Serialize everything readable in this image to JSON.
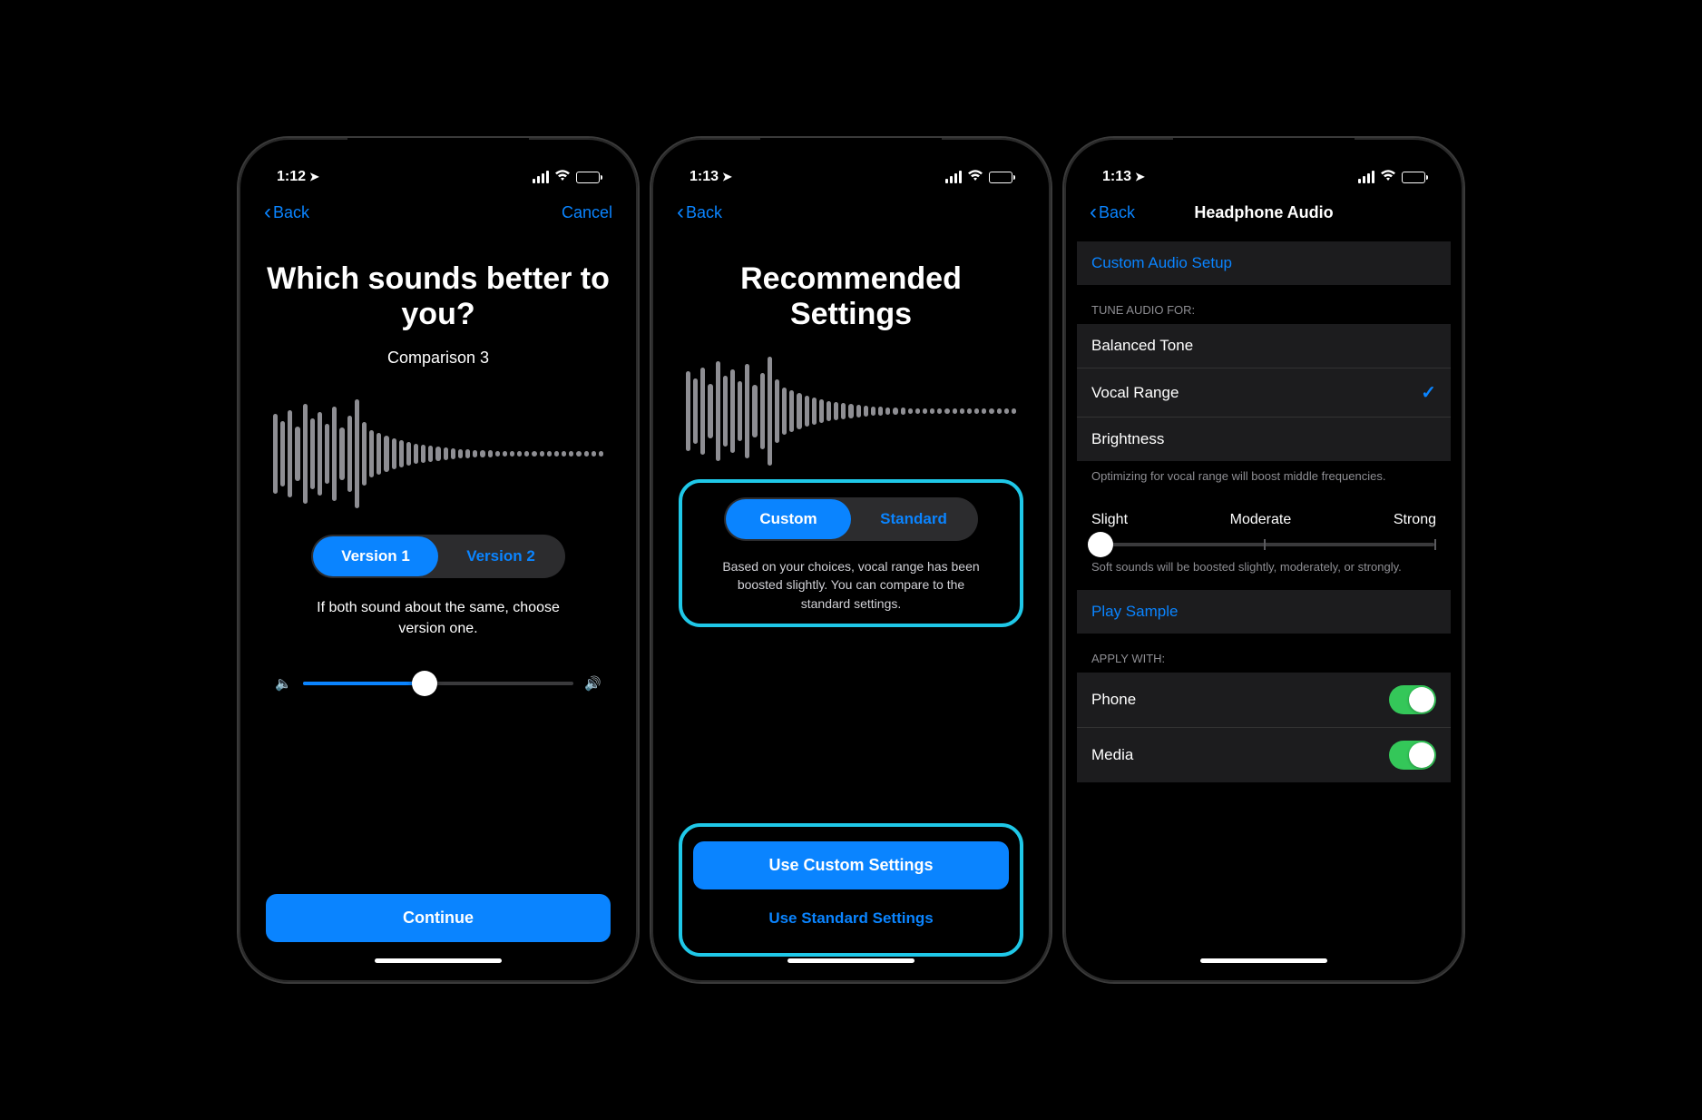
{
  "screen1": {
    "time": "1:12",
    "nav": {
      "back": "Back",
      "cancel": "Cancel"
    },
    "title": "Which sounds better to you?",
    "subtitle": "Comparison 3",
    "segments": {
      "a": "Version 1",
      "b": "Version 2"
    },
    "hint": "If both sound about the same, choose version one.",
    "volume_percent": 45,
    "continue": "Continue"
  },
  "screen2": {
    "time": "1:13",
    "nav": {
      "back": "Back"
    },
    "title": "Recommended Settings",
    "segments": {
      "a": "Custom",
      "b": "Standard"
    },
    "desc": "Based on your choices, vocal range has been boosted slightly. You can compare to the standard settings.",
    "primary": "Use Custom Settings",
    "secondary": "Use Standard Settings"
  },
  "screen3": {
    "time": "1:13",
    "nav": {
      "back": "Back",
      "title": "Headphone Audio"
    },
    "custom_setup": "Custom Audio Setup",
    "tune_header": "TUNE AUDIO FOR:",
    "tune": {
      "balanced": "Balanced Tone",
      "vocal": "Vocal Range",
      "brightness": "Brightness"
    },
    "tune_footer": "Optimizing for vocal range will boost middle frequencies.",
    "strength": {
      "slight": "Slight",
      "moderate": "Moderate",
      "strong": "Strong"
    },
    "strength_footer": "Soft sounds will be boosted slightly, moderately, or strongly.",
    "play_sample": "Play Sample",
    "apply_header": "APPLY WITH:",
    "apply": {
      "phone": "Phone",
      "media": "Media"
    },
    "phone_on": true,
    "media_on": true
  },
  "waveform_heights": [
    88,
    72,
    96,
    60,
    110,
    78,
    92,
    66,
    104,
    58,
    84,
    120,
    70,
    52,
    46,
    40,
    34,
    30,
    26,
    22,
    20,
    18,
    16,
    14,
    12,
    10,
    10,
    8,
    8,
    8,
    6,
    6,
    6,
    6,
    6,
    6,
    6,
    6,
    6,
    6,
    6,
    6,
    6,
    6,
    6
  ]
}
